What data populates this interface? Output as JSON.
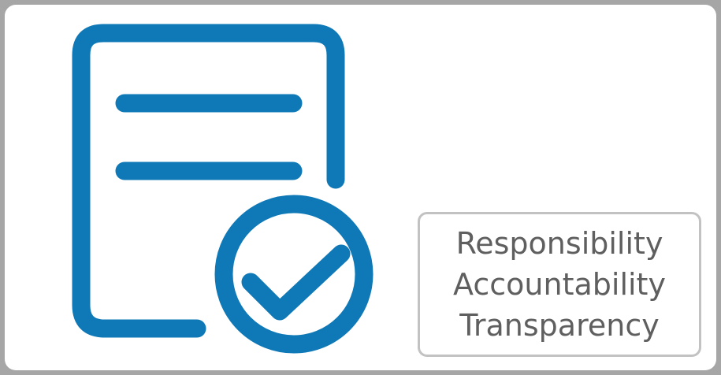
{
  "colors": {
    "frame_border": "#a6a6a6",
    "icon_blue": "#0f79b7",
    "label_text": "#5f5f5f",
    "label_border": "#c2c2c2"
  },
  "icon": "document-checkmark-icon",
  "labels": [
    "Responsibility",
    "Accountability",
    "Transparency"
  ]
}
